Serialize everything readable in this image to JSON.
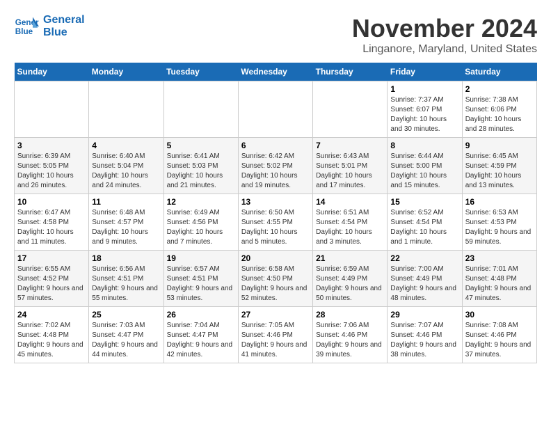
{
  "logo": {
    "line1": "General",
    "line2": "Blue"
  },
  "title": "November 2024",
  "location": "Linganore, Maryland, United States",
  "days_of_week": [
    "Sunday",
    "Monday",
    "Tuesday",
    "Wednesday",
    "Thursday",
    "Friday",
    "Saturday"
  ],
  "weeks": [
    [
      {
        "day": "",
        "info": ""
      },
      {
        "day": "",
        "info": ""
      },
      {
        "day": "",
        "info": ""
      },
      {
        "day": "",
        "info": ""
      },
      {
        "day": "",
        "info": ""
      },
      {
        "day": "1",
        "info": "Sunrise: 7:37 AM\nSunset: 6:07 PM\nDaylight: 10 hours and 30 minutes."
      },
      {
        "day": "2",
        "info": "Sunrise: 7:38 AM\nSunset: 6:06 PM\nDaylight: 10 hours and 28 minutes."
      }
    ],
    [
      {
        "day": "3",
        "info": "Sunrise: 6:39 AM\nSunset: 5:05 PM\nDaylight: 10 hours and 26 minutes."
      },
      {
        "day": "4",
        "info": "Sunrise: 6:40 AM\nSunset: 5:04 PM\nDaylight: 10 hours and 24 minutes."
      },
      {
        "day": "5",
        "info": "Sunrise: 6:41 AM\nSunset: 5:03 PM\nDaylight: 10 hours and 21 minutes."
      },
      {
        "day": "6",
        "info": "Sunrise: 6:42 AM\nSunset: 5:02 PM\nDaylight: 10 hours and 19 minutes."
      },
      {
        "day": "7",
        "info": "Sunrise: 6:43 AM\nSunset: 5:01 PM\nDaylight: 10 hours and 17 minutes."
      },
      {
        "day": "8",
        "info": "Sunrise: 6:44 AM\nSunset: 5:00 PM\nDaylight: 10 hours and 15 minutes."
      },
      {
        "day": "9",
        "info": "Sunrise: 6:45 AM\nSunset: 4:59 PM\nDaylight: 10 hours and 13 minutes."
      }
    ],
    [
      {
        "day": "10",
        "info": "Sunrise: 6:47 AM\nSunset: 4:58 PM\nDaylight: 10 hours and 11 minutes."
      },
      {
        "day": "11",
        "info": "Sunrise: 6:48 AM\nSunset: 4:57 PM\nDaylight: 10 hours and 9 minutes."
      },
      {
        "day": "12",
        "info": "Sunrise: 6:49 AM\nSunset: 4:56 PM\nDaylight: 10 hours and 7 minutes."
      },
      {
        "day": "13",
        "info": "Sunrise: 6:50 AM\nSunset: 4:55 PM\nDaylight: 10 hours and 5 minutes."
      },
      {
        "day": "14",
        "info": "Sunrise: 6:51 AM\nSunset: 4:54 PM\nDaylight: 10 hours and 3 minutes."
      },
      {
        "day": "15",
        "info": "Sunrise: 6:52 AM\nSunset: 4:54 PM\nDaylight: 10 hours and 1 minute."
      },
      {
        "day": "16",
        "info": "Sunrise: 6:53 AM\nSunset: 4:53 PM\nDaylight: 9 hours and 59 minutes."
      }
    ],
    [
      {
        "day": "17",
        "info": "Sunrise: 6:55 AM\nSunset: 4:52 PM\nDaylight: 9 hours and 57 minutes."
      },
      {
        "day": "18",
        "info": "Sunrise: 6:56 AM\nSunset: 4:51 PM\nDaylight: 9 hours and 55 minutes."
      },
      {
        "day": "19",
        "info": "Sunrise: 6:57 AM\nSunset: 4:51 PM\nDaylight: 9 hours and 53 minutes."
      },
      {
        "day": "20",
        "info": "Sunrise: 6:58 AM\nSunset: 4:50 PM\nDaylight: 9 hours and 52 minutes."
      },
      {
        "day": "21",
        "info": "Sunrise: 6:59 AM\nSunset: 4:49 PM\nDaylight: 9 hours and 50 minutes."
      },
      {
        "day": "22",
        "info": "Sunrise: 7:00 AM\nSunset: 4:49 PM\nDaylight: 9 hours and 48 minutes."
      },
      {
        "day": "23",
        "info": "Sunrise: 7:01 AM\nSunset: 4:48 PM\nDaylight: 9 hours and 47 minutes."
      }
    ],
    [
      {
        "day": "24",
        "info": "Sunrise: 7:02 AM\nSunset: 4:48 PM\nDaylight: 9 hours and 45 minutes."
      },
      {
        "day": "25",
        "info": "Sunrise: 7:03 AM\nSunset: 4:47 PM\nDaylight: 9 hours and 44 minutes."
      },
      {
        "day": "26",
        "info": "Sunrise: 7:04 AM\nSunset: 4:47 PM\nDaylight: 9 hours and 42 minutes."
      },
      {
        "day": "27",
        "info": "Sunrise: 7:05 AM\nSunset: 4:46 PM\nDaylight: 9 hours and 41 minutes."
      },
      {
        "day": "28",
        "info": "Sunrise: 7:06 AM\nSunset: 4:46 PM\nDaylight: 9 hours and 39 minutes."
      },
      {
        "day": "29",
        "info": "Sunrise: 7:07 AM\nSunset: 4:46 PM\nDaylight: 9 hours and 38 minutes."
      },
      {
        "day": "30",
        "info": "Sunrise: 7:08 AM\nSunset: 4:46 PM\nDaylight: 9 hours and 37 minutes."
      }
    ]
  ]
}
